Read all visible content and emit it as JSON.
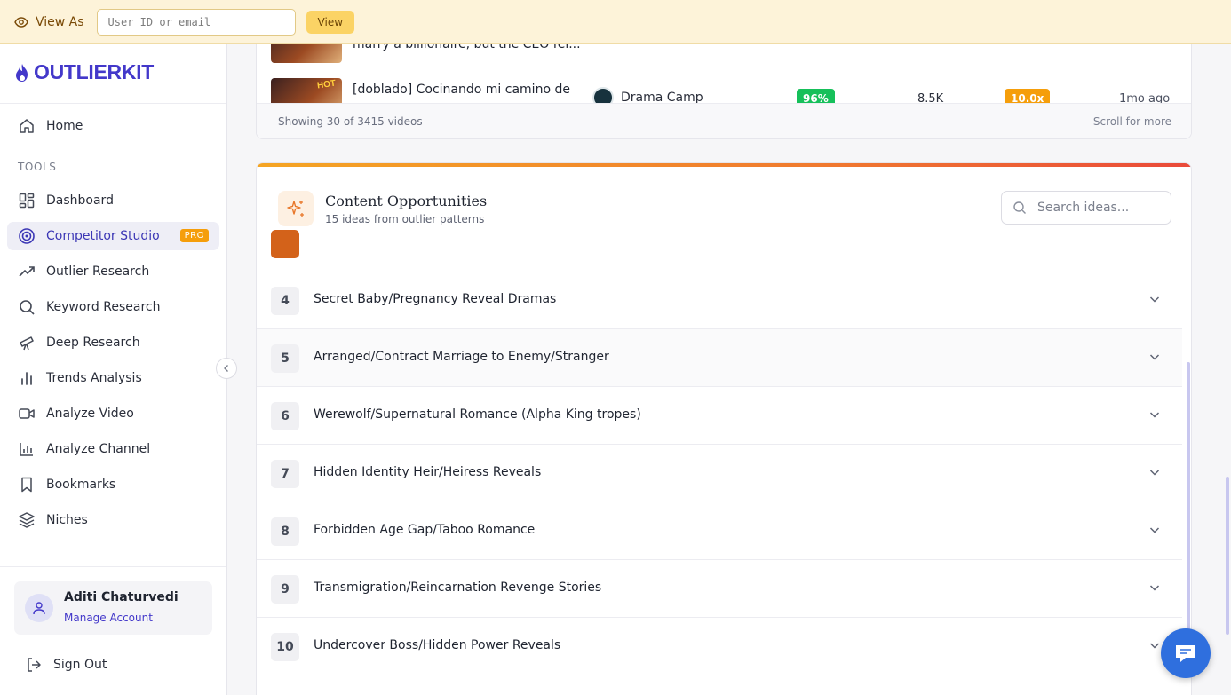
{
  "viewas": {
    "label": "View As",
    "input_placeholder": "User ID or email",
    "button": "View"
  },
  "sidebar": {
    "logo": "OUTLIERKIT",
    "home": "Home",
    "tools_label": "TOOLS",
    "items": [
      {
        "label": "Dashboard",
        "icon": "dashboard-icon"
      },
      {
        "label": "Competitor Studio",
        "icon": "target-icon",
        "badge": "PRO",
        "active": true
      },
      {
        "label": "Outlier Research",
        "icon": "trending-icon"
      },
      {
        "label": "Keyword Research",
        "icon": "search-icon"
      },
      {
        "label": "Deep Research",
        "icon": "telescope-icon"
      },
      {
        "label": "Trends Analysis",
        "icon": "bar-chart-icon"
      },
      {
        "label": "Analyze Video",
        "icon": "video-icon"
      },
      {
        "label": "Analyze Channel",
        "icon": "chart-icon"
      },
      {
        "label": "Bookmarks",
        "icon": "bookmark-icon"
      },
      {
        "label": "Niches",
        "icon": "layers-icon"
      }
    ],
    "account": {
      "name": "Aditi Chaturvedi",
      "manage": "Manage Account"
    },
    "signout": "Sign Out"
  },
  "videos": {
    "rows": [
      {
        "title": "marry a billionaire, but the CEO fel...",
        "channel": "",
        "score": "",
        "views": "",
        "multiplier": "",
        "age": ""
      },
      {
        "title": "[doblado] Cocinando mi camino de",
        "channel": "Drama Camp",
        "score": "96%",
        "views": "8.5K",
        "multiplier": "10.0x",
        "age": "1mo ago",
        "badge": "HOT"
      }
    ],
    "showing": "Showing 30 of 3415 videos",
    "scroll_hint": "Scroll for more"
  },
  "opportunities": {
    "title": "Content Opportunities",
    "subtitle": "15 ideas from outlier patterns",
    "search_placeholder": "Search ideas...",
    "ideas": [
      {
        "num": "4",
        "text": "Secret Baby/Pregnancy Reveal Dramas"
      },
      {
        "num": "5",
        "text": "Arranged/Contract Marriage to Enemy/Stranger"
      },
      {
        "num": "6",
        "text": "Werewolf/Supernatural Romance (Alpha King tropes)"
      },
      {
        "num": "7",
        "text": "Hidden Identity Heir/Heiress Reveals"
      },
      {
        "num": "8",
        "text": "Forbidden Age Gap/Taboo Romance"
      },
      {
        "num": "9",
        "text": "Transmigration/Reincarnation Revenge Stories"
      },
      {
        "num": "10",
        "text": "Undercover Boss/Hidden Power Reveals"
      }
    ]
  },
  "colors": {
    "accent": "#4338ca",
    "pro": "#f59e0b",
    "score": "#16c05a",
    "chat": "#2f6fde"
  }
}
